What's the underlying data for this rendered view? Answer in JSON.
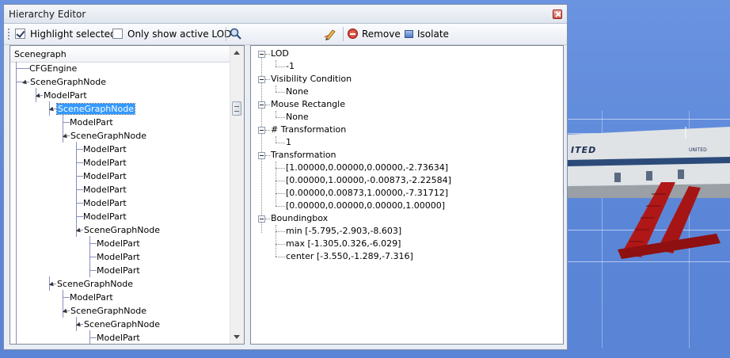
{
  "window": {
    "title": "Hierarchy Editor"
  },
  "toolbar": {
    "highlight_selected": {
      "label": "Highlight selected",
      "checked": true
    },
    "only_active_lod": {
      "label": "Only show active LOD",
      "checked": false
    },
    "remove_label": "Remove",
    "isolate_label": "Isolate"
  },
  "tree": {
    "header": "Scenegraph",
    "nodes": [
      {
        "label": "CFGEngine",
        "depth": 0,
        "expanded": false,
        "selected": false
      },
      {
        "label": "SceneGraphNode",
        "depth": 0,
        "expanded": true,
        "selected": false
      },
      {
        "label": "ModelPart",
        "depth": 1,
        "expanded": true,
        "selected": false
      },
      {
        "label": "SceneGraphNode",
        "depth": 2,
        "expanded": true,
        "selected": true
      },
      {
        "label": "ModelPart",
        "depth": 3,
        "expanded": false,
        "selected": false
      },
      {
        "label": "SceneGraphNode",
        "depth": 3,
        "expanded": true,
        "selected": false
      },
      {
        "label": "ModelPart",
        "depth": 4,
        "expanded": false,
        "selected": false
      },
      {
        "label": "ModelPart",
        "depth": 4,
        "expanded": false,
        "selected": false
      },
      {
        "label": "ModelPart",
        "depth": 4,
        "expanded": false,
        "selected": false
      },
      {
        "label": "ModelPart",
        "depth": 4,
        "expanded": false,
        "selected": false
      },
      {
        "label": "ModelPart",
        "depth": 4,
        "expanded": false,
        "selected": false
      },
      {
        "label": "ModelPart",
        "depth": 4,
        "expanded": false,
        "selected": false
      },
      {
        "label": "SceneGraphNode",
        "depth": 4,
        "expanded": true,
        "selected": false
      },
      {
        "label": "ModelPart",
        "depth": 5,
        "expanded": false,
        "selected": false
      },
      {
        "label": "ModelPart",
        "depth": 5,
        "expanded": false,
        "selected": false
      },
      {
        "label": "ModelPart",
        "depth": 5,
        "expanded": false,
        "selected": false
      },
      {
        "label": "SceneGraphNode",
        "depth": 2,
        "expanded": true,
        "selected": false
      },
      {
        "label": "ModelPart",
        "depth": 3,
        "expanded": false,
        "selected": false
      },
      {
        "label": "SceneGraphNode",
        "depth": 3,
        "expanded": true,
        "selected": false
      },
      {
        "label": "SceneGraphNode",
        "depth": 4,
        "expanded": true,
        "selected": false
      },
      {
        "label": "ModelPart",
        "depth": 5,
        "expanded": false,
        "selected": false
      }
    ]
  },
  "properties": [
    {
      "label": "LOD",
      "values": [
        "-1"
      ]
    },
    {
      "label": "Visibility Condition",
      "values": [
        "None"
      ]
    },
    {
      "label": "Mouse Rectangle",
      "values": [
        "None"
      ]
    },
    {
      "label": "# Transformation",
      "values": [
        "1"
      ]
    },
    {
      "label": "Transformation",
      "values": [
        "[1.00000,0.00000,0.00000,-2.73634]",
        "[0.00000,1.00000,-0.00873,-2.22584]",
        "[0.00000,0.00873,1.00000,-7.31712]",
        "[0.00000,0.00000,0.00000,1.00000]"
      ]
    },
    {
      "label": "Boundingbox",
      "values": [
        "min [-5.795,-2.903,-8.603]",
        "max [-1.305,0.326,-6.029]",
        "center [-3.550,-1.289,-7.316]"
      ]
    }
  ],
  "background_model": {
    "fuselage_text": "ITED",
    "tail_text": "UNITED"
  },
  "colors": {
    "sky": "#5b86d8",
    "selection": "#3399ff",
    "stairs": "#b01818"
  }
}
